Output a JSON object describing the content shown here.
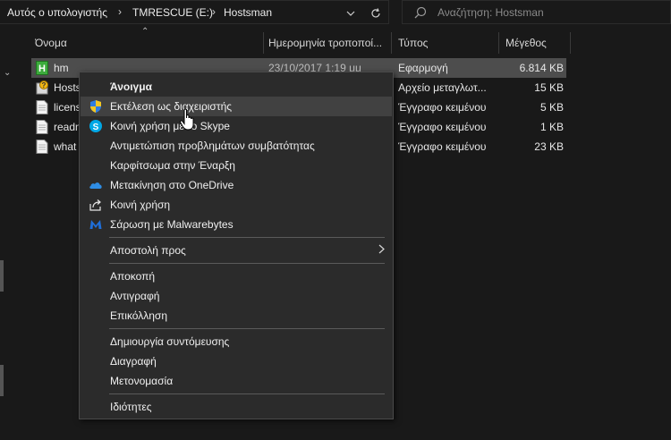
{
  "breadcrumb": {
    "items": [
      "Αυτός ο υπολογιστής",
      "TMRESCUE (E:)",
      "Hostsman"
    ]
  },
  "search": {
    "placeholder": "Αναζήτηση: Hostsman"
  },
  "columns": {
    "name": "Όνομα",
    "date": "Ημερομηνία τροποποί...",
    "type": "Τύπος",
    "size": "Μέγεθος"
  },
  "files": [
    {
      "name": "hm",
      "date": "23/10/2017 1:19 μμ",
      "type": "Εφαρμογή",
      "size": "6.814 KB",
      "icon": "exe-icon",
      "selected": true
    },
    {
      "name": "Hosts",
      "date": "",
      "type": "Αρχείο μεταγλωτ...",
      "size": "15 KB",
      "icon": "help-file-icon",
      "selected": false
    },
    {
      "name": "licens",
      "date": "",
      "type": "Έγγραφο κειμένου",
      "size": "5 KB",
      "icon": "text-file-icon",
      "selected": false
    },
    {
      "name": "readm",
      "date": "",
      "type": "Έγγραφο κειμένου",
      "size": "1 KB",
      "icon": "text-file-icon",
      "selected": false
    },
    {
      "name": "what",
      "date": "",
      "type": "Έγγραφο κειμένου",
      "size": "23 KB",
      "icon": "text-file-icon",
      "selected": false
    }
  ],
  "context_menu": {
    "open": "Άνοιγμα",
    "run_as_admin": "Εκτέλεση ως διαχειριστής",
    "share_skype": "Κοινή χρήση με το Skype",
    "troubleshoot": "Αντιμετώπιση προβλημάτων συμβατότητας",
    "pin_start": "Καρφίτσωμα στην Έναρξη",
    "move_onedrive": "Μετακίνηση στο OneDrive",
    "share": "Κοινή χρήση",
    "scan_malwarebytes": "Σάρωση με Malwarebytes",
    "send_to": "Αποστολή προς",
    "cut": "Αποκοπή",
    "copy": "Αντιγραφή",
    "paste": "Επικόλληση",
    "create_shortcut": "Δημιουργία συντόμευσης",
    "delete": "Διαγραφή",
    "rename": "Μετονομασία",
    "properties": "Ιδιότητες"
  },
  "colors": {
    "background": "#191919",
    "menu_bg": "#2b2b2b",
    "highlight": "#414141",
    "selected_row": "#4d4d4d"
  }
}
